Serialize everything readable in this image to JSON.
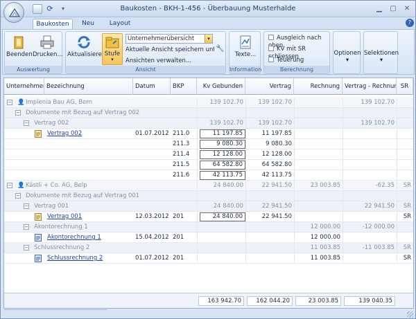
{
  "window": {
    "title": "Baukosten - BKH-1-456 - Überbauung Musterhalde"
  },
  "tabs": [
    {
      "label": "Baukosten"
    },
    {
      "label": "Neu"
    },
    {
      "label": "Layout"
    }
  ],
  "ribbon": {
    "groups": {
      "auswertung": {
        "label": "Auswertung",
        "beenden": "Beenden",
        "drucken": "Drucken..."
      },
      "ansicht": {
        "label": "Ansicht",
        "aktualisieren": "Aktualisieren",
        "stufe": "Stufe",
        "combo_value": "Unternehmerübersicht",
        "save_view": "Aktuelle Ansicht speichern unter...",
        "manage_views": "Ansichten verwalten..."
      },
      "information": {
        "label": "Information",
        "texte": "Texte..."
      },
      "berechnung": {
        "label": "Berechnung",
        "check1": "Ausgleich nach oben",
        "check2": "KV mit SR schliessen",
        "check3": "Teuerung"
      },
      "optionen": "Optionen",
      "selektionen": "Selektionen"
    }
  },
  "grid": {
    "columns": [
      "Unternehmer",
      "Bezeichnung",
      "Datum",
      "BKP",
      "Kv Gebunden",
      "Vertrag",
      "Rechnung",
      "Vertrag - Rechnung",
      "SR"
    ],
    "rows": [
      {
        "kind": "g1",
        "label": "Implenia Bau AG, Bern",
        "kv": "139 102.70",
        "vertrag": "139 102.70",
        "rechnung": "",
        "diff": "139 102.70",
        "sr": ""
      },
      {
        "kind": "g2",
        "label": "Dokumente mit Bezug auf Vertrag 002"
      },
      {
        "kind": "g3",
        "label": "Vertrag 002",
        "kv": "139 102.70",
        "vertrag": "139 102.70",
        "rechnung": "",
        "diff": "139 102.70",
        "sr": ""
      },
      {
        "kind": "d",
        "icon": "contract",
        "bez": "Vertrag 002",
        "datum": "01.07.2012",
        "bkp": "211.0",
        "kv": "11 197.85",
        "vertrag": "11 197.85",
        "rechnung": "",
        "diff": "",
        "sr": ""
      },
      {
        "kind": "d",
        "bez": "",
        "datum": "",
        "bkp": "211.3",
        "kv": "9 080.30",
        "vertrag": "9 080.30",
        "rechnung": "",
        "diff": "",
        "sr": ""
      },
      {
        "kind": "d",
        "bez": "",
        "datum": "",
        "bkp": "211.4",
        "kv": "12 128.00",
        "vertrag": "12 128.00",
        "rechnung": "",
        "diff": "",
        "sr": ""
      },
      {
        "kind": "d",
        "bez": "",
        "datum": "",
        "bkp": "211.5",
        "kv": "64 582.80",
        "vertrag": "64 582.80",
        "rechnung": "",
        "diff": "",
        "sr": ""
      },
      {
        "kind": "d",
        "bez": "",
        "datum": "",
        "bkp": "211.6",
        "kv": "42 113.75",
        "vertrag": "42 113.75",
        "rechnung": "",
        "diff": "",
        "sr": ""
      },
      {
        "kind": "g1",
        "label": "Kästli  + Co. AG, Belp",
        "kv": "24 840.00",
        "vertrag": "22 941.50",
        "rechnung": "23 003.85",
        "diff": "-62.35",
        "sr": "SR"
      },
      {
        "kind": "g2",
        "label": "Dokumente mit Bezug auf Vertrag 001"
      },
      {
        "kind": "g3",
        "label": "Vertrag 001",
        "kv": "24 840.00",
        "vertrag": "22 941.50",
        "rechnung": "",
        "diff": "22 941.50",
        "sr": "SR"
      },
      {
        "kind": "d",
        "icon": "contract",
        "bez": "Vertrag 001",
        "datum": "12.03.2012",
        "bkp": "201",
        "kv": "24 840.00",
        "vertrag": "22 941.50",
        "rechnung": "",
        "diff": "",
        "sr": "SR"
      },
      {
        "kind": "g3",
        "label": "Akontorechnung 1",
        "kv": "",
        "vertrag": "",
        "rechnung": "12 000.00",
        "diff": "-12 000.00",
        "sr": ""
      },
      {
        "kind": "d",
        "icon": "invoice",
        "bez": "Akontorechnung 1",
        "datum": "15.04.2012",
        "bkp": "201",
        "kv": "",
        "vertrag": "",
        "rechnung": "12 000.00",
        "diff": "",
        "sr": ""
      },
      {
        "kind": "g3",
        "label": "Schlussrechnung 2",
        "kv": "",
        "vertrag": "",
        "rechnung": "11 003.85",
        "diff": "-11 003.85",
        "sr": "SR"
      },
      {
        "kind": "d",
        "icon": "invoice",
        "bez": "Schlussrechnung 2",
        "datum": "01.07.2012",
        "bkp": "201",
        "kv": "",
        "vertrag": "",
        "rechnung": "11 003.85",
        "diff": "",
        "sr": "SR"
      }
    ],
    "totals": {
      "kv": "163 942.70",
      "vertrag": "162 044.20",
      "rechnung": "23 003.85",
      "diff": "139 040.35"
    }
  }
}
